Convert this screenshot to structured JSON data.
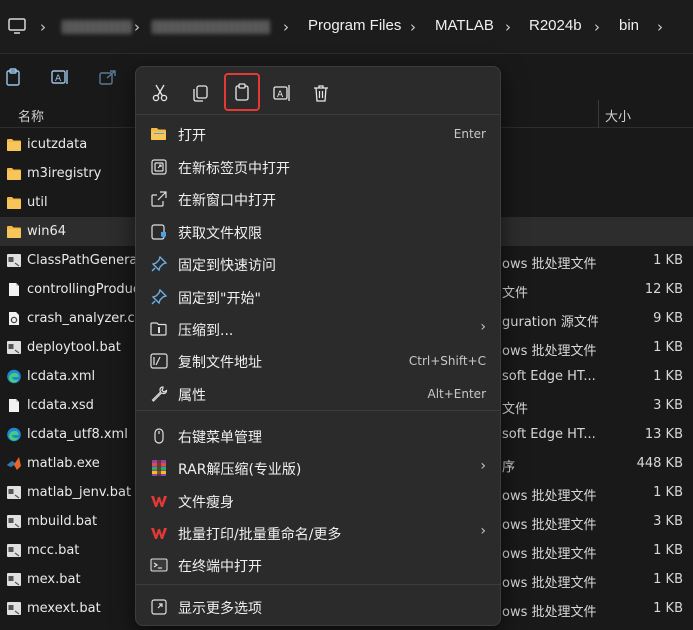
{
  "breadcrumb": [
    "Program Files",
    "MATLAB",
    "R2024b",
    "bin"
  ],
  "columns": {
    "name": "名称",
    "size": "大小"
  },
  "files": [
    {
      "name": "icutzdata",
      "type": "",
      "size": "",
      "icon": "folder-icon"
    },
    {
      "name": "m3iregistry",
      "type": "",
      "size": "",
      "icon": "folder-icon"
    },
    {
      "name": "util",
      "type": "",
      "size": "",
      "icon": "folder-icon"
    },
    {
      "name": "win64",
      "type": "",
      "size": "",
      "icon": "folder-icon"
    },
    {
      "name": "ClassPathGenerator.bat",
      "type": "ows 批处理文件",
      "size": "1 KB",
      "icon": "bat-file-icon"
    },
    {
      "name": "controllingProductList",
      "type": "文件",
      "size": "12 KB",
      "icon": "file-icon"
    },
    {
      "name": "crash_analyzer.cfg",
      "type": "guration 源文件",
      "size": "9 KB",
      "icon": "cfg-file-icon"
    },
    {
      "name": "deploytool.bat",
      "type": "ows 批处理文件",
      "size": "1 KB",
      "icon": "bat-file-icon"
    },
    {
      "name": "lcdata.xml",
      "type": "soft Edge HT...",
      "size": "1 KB",
      "icon": "edge-icon"
    },
    {
      "name": "lcdata.xsd",
      "type": "文件",
      "size": "3 KB",
      "icon": "file-icon"
    },
    {
      "name": "lcdata_utf8.xml",
      "type": "soft Edge HT...",
      "size": "13 KB",
      "icon": "edge-icon"
    },
    {
      "name": "matlab.exe",
      "type": "序",
      "size": "448 KB",
      "icon": "matlab-icon"
    },
    {
      "name": "matlab_jenv.bat",
      "type": "ows 批处理文件",
      "size": "1 KB",
      "icon": "bat-file-icon"
    },
    {
      "name": "mbuild.bat",
      "type": "ows 批处理文件",
      "size": "3 KB",
      "icon": "bat-file-icon"
    },
    {
      "name": "mcc.bat",
      "type": "ows 批处理文件",
      "size": "1 KB",
      "icon": "bat-file-icon"
    },
    {
      "name": "mex.bat",
      "type": "ows 批处理文件",
      "size": "1 KB",
      "icon": "bat-file-icon"
    },
    {
      "name": "mexext.bat",
      "type": "ows 批处理文件",
      "size": "1 KB",
      "icon": "bat-file-icon"
    }
  ],
  "context_menu": {
    "quick_actions": [
      "cut-icon",
      "copy-icon",
      "paste-icon",
      "rename-icon",
      "delete-icon"
    ],
    "items": [
      {
        "label": "打开",
        "shortcut": "Enter",
        "icon": "folder-open-icon",
        "arrow": false
      },
      {
        "label": "在新标签页中打开",
        "shortcut": "",
        "icon": "new-tab-icon",
        "arrow": false
      },
      {
        "label": "在新窗口中打开",
        "shortcut": "",
        "icon": "new-window-icon",
        "arrow": false
      },
      {
        "label": "获取文件权限",
        "shortcut": "",
        "icon": "permission-icon",
        "arrow": false
      },
      {
        "label": "固定到快速访问",
        "shortcut": "",
        "icon": "pin-icon",
        "arrow": false
      },
      {
        "label": "固定到\"开始\"",
        "shortcut": "",
        "icon": "pin-start-icon",
        "arrow": false
      },
      {
        "label": "压缩到...",
        "shortcut": "",
        "icon": "zip-icon",
        "arrow": true
      },
      {
        "label": "复制文件地址",
        "shortcut": "Ctrl+Shift+C",
        "icon": "copy-path-icon",
        "arrow": false
      },
      {
        "label": "属性",
        "shortcut": "Alt+Enter",
        "icon": "wrench-icon",
        "arrow": false
      },
      {
        "label": "右键菜单管理",
        "shortcut": "",
        "icon": "mouse-icon",
        "arrow": false
      },
      {
        "label": "RAR解压缩(专业版)",
        "shortcut": "",
        "icon": "rar-icon",
        "arrow": true
      },
      {
        "label": "文件瘦身",
        "shortcut": "",
        "icon": "wps-icon",
        "arrow": false
      },
      {
        "label": "批量打印/批量重命名/更多",
        "shortcut": "",
        "icon": "wps-icon",
        "arrow": true
      },
      {
        "label": "在终端中打开",
        "shortcut": "",
        "icon": "terminal-icon",
        "arrow": false
      },
      {
        "label": "显示更多选项",
        "shortcut": "",
        "icon": "more-options-icon",
        "arrow": false
      }
    ]
  },
  "colors": {
    "highlight": "#e53935",
    "folder": "#f4b942",
    "accent": "#4aa3df"
  }
}
